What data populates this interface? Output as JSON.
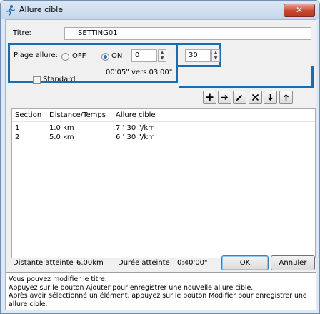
{
  "window": {
    "title": "Allure cible",
    "close_label": "✕"
  },
  "form": {
    "title_label": "Titre:",
    "title_value": "SETTING01",
    "range_label": "Plage allure:",
    "off_label": "OFF",
    "on_label": "ON",
    "on_selected": true,
    "minutes_value": "0",
    "seconds_value": "30",
    "minute_mark": "'",
    "range_text": "00'05\" vers 03'00\"",
    "standard_label": "Standard",
    "standard_checked": false
  },
  "toolbar": {
    "buttons": [
      {
        "name": "add-button",
        "icon": "plus-icon"
      },
      {
        "name": "move-right-button",
        "icon": "arrow-right-icon"
      },
      {
        "name": "edit-button",
        "icon": "pencil-icon"
      },
      {
        "name": "delete-button",
        "icon": "x-icon"
      },
      {
        "name": "move-down-button",
        "icon": "arrow-down-icon"
      },
      {
        "name": "move-up-button",
        "icon": "arrow-up-icon"
      }
    ]
  },
  "table": {
    "columns": [
      "Section",
      "Distance/Temps",
      "Allure cible"
    ],
    "rows": [
      [
        "1",
        "1.0 km",
        "7 ' 30 \"/km"
      ],
      [
        "2",
        "5.0 km",
        "6 ' 30 \"/km"
      ]
    ]
  },
  "footer": {
    "distance_label": "Distante atteinte",
    "distance_value": "6.00km",
    "duration_label": "Durée atteinte",
    "duration_value": "0:40'00\"",
    "ok_label": "OK",
    "cancel_label": "Annuler"
  },
  "help_text": [
    "Vous pouvez modifier le titre.",
    "Appuyez sur le bouton Ajouter pour enregistrer une nouvelle allure cible.",
    "Après avoir sélectionné un élément, appuyez sur le bouton Modifier pour enregistrer une allure cible."
  ]
}
